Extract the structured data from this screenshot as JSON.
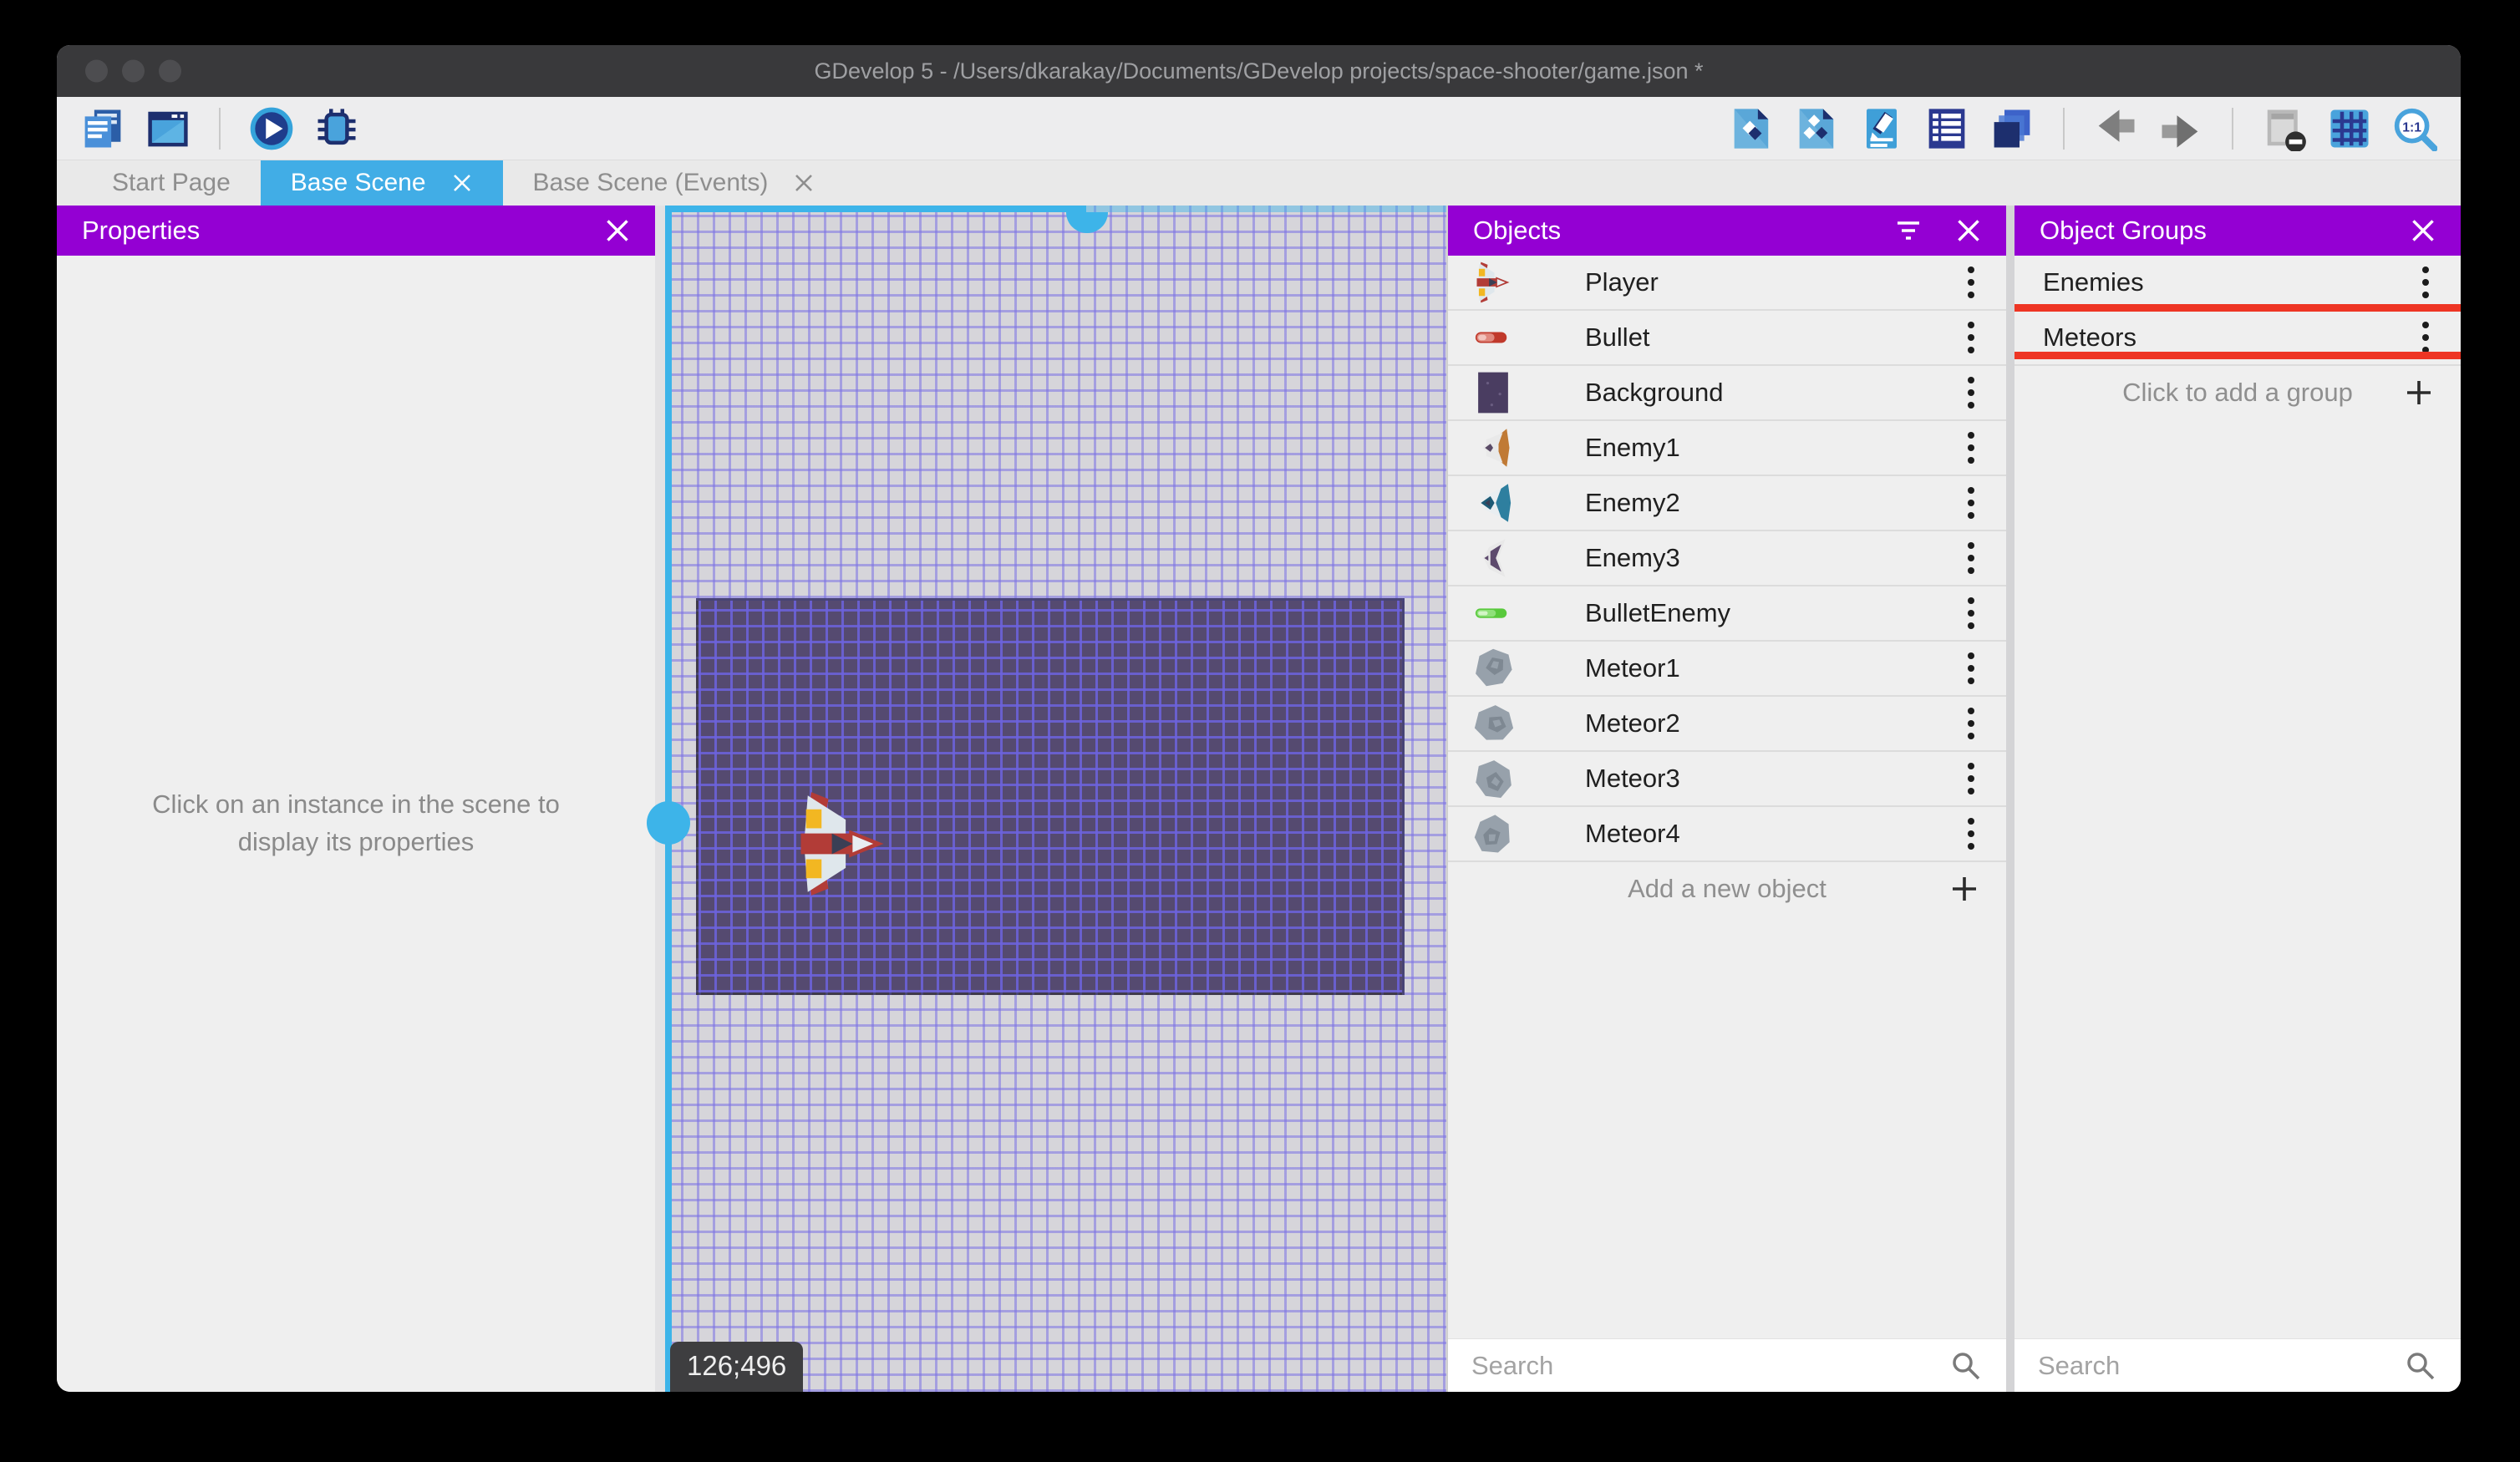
{
  "window": {
    "title": "GDevelop 5 - /Users/dkarakay/Documents/GDevelop projects/space-shooter/game.json *"
  },
  "toolbar": {
    "left_icons": [
      "project-manager-icon",
      "scene-editor-icon",
      "separator",
      "play-icon",
      "debug-icon"
    ],
    "right_icons": [
      "objects-panel-icon",
      "object-groups-panel-icon",
      "properties-panel-icon",
      "instances-list-icon",
      "layers-panel-icon",
      "separator",
      "undo-icon",
      "redo-icon",
      "separator",
      "mask-instances-icon",
      "grid-icon",
      "zoom-1-1-icon"
    ]
  },
  "tabs": [
    {
      "label": "Start Page",
      "active": false,
      "closable": false
    },
    {
      "label": "Base Scene",
      "active": true,
      "closable": true
    },
    {
      "label": "Base Scene (Events)",
      "active": false,
      "closable": true
    }
  ],
  "properties_panel": {
    "title": "Properties",
    "empty_message": "Click on an instance in the scene to display its properties"
  },
  "scene": {
    "cursor_coordinates": "126;496"
  },
  "objects_panel": {
    "title": "Objects",
    "header_icons": [
      "filter-icon",
      "close-icon"
    ],
    "items": [
      {
        "name": "Player",
        "icon": "player-ship-icon"
      },
      {
        "name": "Bullet",
        "icon": "bullet-icon"
      },
      {
        "name": "Background",
        "icon": "background-icon"
      },
      {
        "name": "Enemy1",
        "icon": "enemy1-ship-icon"
      },
      {
        "name": "Enemy2",
        "icon": "enemy2-ship-icon"
      },
      {
        "name": "Enemy3",
        "icon": "enemy3-ship-icon"
      },
      {
        "name": "BulletEnemy",
        "icon": "enemy-bullet-icon"
      },
      {
        "name": "Meteor1",
        "icon": "meteor-icon"
      },
      {
        "name": "Meteor2",
        "icon": "meteor-icon"
      },
      {
        "name": "Meteor3",
        "icon": "meteor-icon"
      },
      {
        "name": "Meteor4",
        "icon": "meteor-icon"
      }
    ],
    "add_label": "Add a new object",
    "search_placeholder": "Search"
  },
  "object_groups_panel": {
    "title": "Object Groups",
    "header_icons": [
      "close-icon"
    ],
    "items": [
      {
        "name": "Enemies",
        "highlighted": false
      },
      {
        "name": "Meteors",
        "highlighted": true
      }
    ],
    "add_label": "Click to add a group",
    "search_placeholder": "Search"
  },
  "colors": {
    "header_purple": "#9400d3",
    "active_tab_blue": "#41ade6",
    "selection_cyan": "#3db4e9",
    "annotation_red": "#ee3524",
    "scene_background_purple": "#554a70"
  }
}
